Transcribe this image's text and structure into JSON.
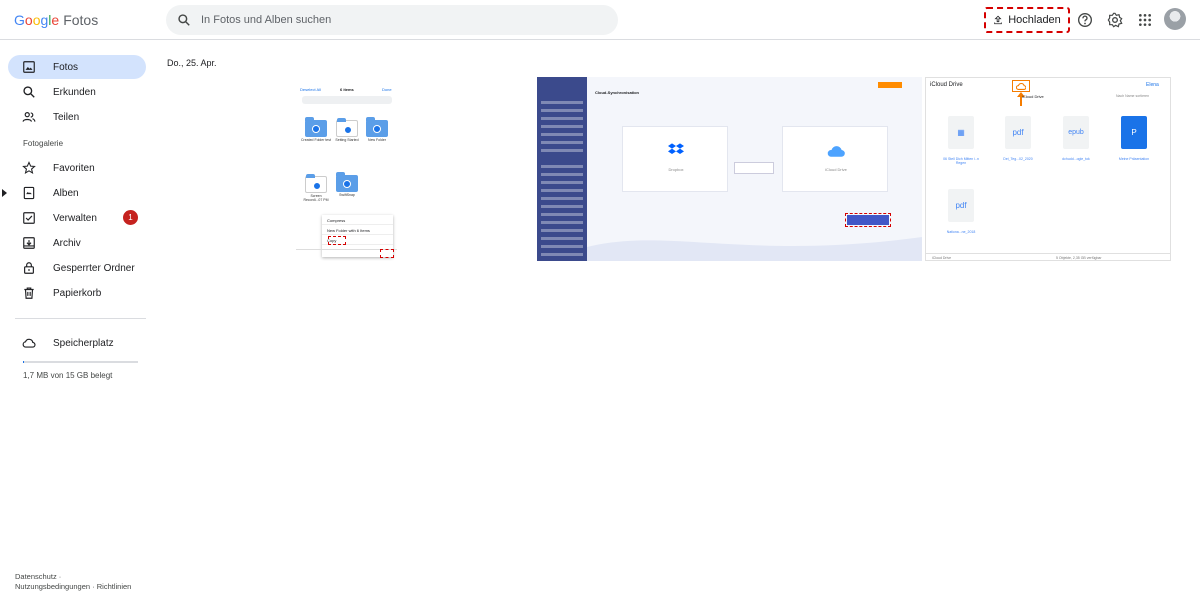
{
  "header": {
    "logo": {
      "g1": "G",
      "g2": "o",
      "g3": "o",
      "g4": "g",
      "g5": "l",
      "g6": "e",
      "product": "Fotos"
    },
    "search_placeholder": "In Fotos und Alben suchen",
    "upload_label": "Hochladen",
    "icons": [
      "upload-icon",
      "help-icon",
      "settings-icon",
      "apps-icon",
      "account-avatar"
    ]
  },
  "sidebar": {
    "items": [
      {
        "label": "Fotos",
        "icon": "photo-icon",
        "active": true
      },
      {
        "label": "Erkunden",
        "icon": "search-icon"
      },
      {
        "label": "Teilen",
        "icon": "people-icon"
      }
    ],
    "section_label": "Fotogalerie",
    "library": [
      {
        "label": "Favoriten",
        "icon": "star-icon"
      },
      {
        "label": "Alben",
        "icon": "album-icon"
      },
      {
        "label": "Verwalten",
        "icon": "manage-icon",
        "badge": "1"
      },
      {
        "label": "Archiv",
        "icon": "archive-icon"
      },
      {
        "label": "Gesperrter Ordner",
        "icon": "lock-icon"
      },
      {
        "label": "Papierkorb",
        "icon": "trash-icon"
      }
    ],
    "storage": {
      "label": "Speicherplatz",
      "icon": "cloud-icon",
      "used_text": "1,7 MB von 15 GB belegt",
      "used_fraction": 0.01
    },
    "footer": {
      "privacy": "Datenschutz",
      "terms": "Nutzungsbedingungen",
      "guidelines": "Richtlinien"
    }
  },
  "main": {
    "date": "Do., 25. Apr.",
    "photo1": {
      "deselect": "Deselect All",
      "count": "6 items",
      "done": "Done",
      "folders": [
        "Created Folder test",
        "Setting Started",
        "New Folder",
        "Screen Recordi...07 PM",
        "SwiftSnap"
      ],
      "menu": [
        "Compress",
        "New Folder with 6 Items",
        "Copy"
      ]
    },
    "photo2": {
      "title": "Cloud-Synchronisation",
      "left_card": "Dropbox",
      "right_card": "iCloud Drive",
      "button": "Jetzt synchronisieren"
    },
    "photo3": {
      "title": "iCloud Drive",
      "user": "Elena",
      "sort": "Nach Name sortieren",
      "files": [
        {
          "ext": "▦",
          "name": "06 Stell Dich Mitten i..n Regen"
        },
        {
          "ext": "pdf",
          "name": "Dei_Teg...02_2020"
        },
        {
          "ext": "epub",
          "name": "dchudd...ogle_tok"
        },
        {
          "ext": "P",
          "name": "Meine Präsentation"
        },
        {
          "ext": "pdf",
          "name": "Nationa...ne_2018"
        }
      ],
      "status": "5 Objekte, 2,35 GB verfügbar",
      "footer_left": "iCloud Drive"
    }
  }
}
